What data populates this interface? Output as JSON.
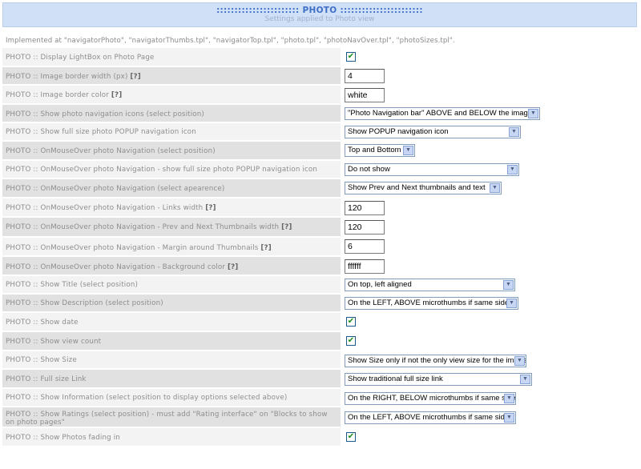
{
  "header": {
    "title": "::::::::::::::::::::::: PHOTO :::::::::::::::::::::::",
    "subtitle": "Settings applied to Photo view"
  },
  "implemented": "Implemented at \"navigatorPhoto\", \"navigatorThumbs.tpl\", \"navigatorTop.tpl\", \"photo.tpl\", \"photoNavOver.tpl\", \"photoSizes.tpl\".",
  "rows": [
    {
      "label": "PHOTO :: Display LightBox on Photo Page",
      "help": "",
      "type": "checkbox",
      "checked": true
    },
    {
      "label": "PHOTO :: Image border width (px)",
      "help": "[?]",
      "type": "text",
      "value": "4"
    },
    {
      "label": "PHOTO :: Image border color",
      "help": "[?]",
      "type": "text",
      "value": "white"
    },
    {
      "label": "PHOTO :: Show photo navigation icons (select position)",
      "help": "",
      "type": "select",
      "value": "\"Photo Navigation bar\" ABOVE and BELOW the image"
    },
    {
      "label": "PHOTO :: Show full size photo POPUP navigation icon",
      "help": "",
      "type": "select",
      "value": "Show POPUP navigation icon"
    },
    {
      "label": "PHOTO :: OnMouseOver photo Navigation (select position)",
      "help": "",
      "type": "select",
      "value": "Top and Bottom"
    },
    {
      "label": "PHOTO :: OnMouseOver photo Navigation - show full size photo POPUP navigation icon",
      "help": "",
      "type": "select",
      "value": "Do not show"
    },
    {
      "label": "PHOTO :: OnMouseOver photo Navigation (select apearence)",
      "help": "",
      "type": "select",
      "value": "Show Prev and Next thumbnails and text"
    },
    {
      "label": "PHOTO :: OnMouseOver photo Navigation - Links width",
      "help": "[?]",
      "type": "text",
      "value": "120"
    },
    {
      "label": "PHOTO :: OnMouseOver photo Navigation - Prev and Next Thumbnails width",
      "help": "[?]",
      "type": "text",
      "value": "120"
    },
    {
      "label": "PHOTO :: OnMouseOver photo Navigation - Margin around Thumbnails",
      "help": "[?]",
      "type": "text",
      "value": "6"
    },
    {
      "label": "PHOTO :: OnMouseOver photo Navigation - Background color",
      "help": "[?]",
      "type": "text",
      "value": "ffffff"
    },
    {
      "label": "PHOTO :: Show Title (select position)",
      "help": "",
      "type": "select",
      "value": "On top, left aligned"
    },
    {
      "label": "PHOTO :: Show Description (select position)",
      "help": "",
      "type": "select",
      "value": "On the LEFT, ABOVE microthumbs if same side"
    },
    {
      "label": "PHOTO :: Show date",
      "help": "",
      "type": "checkbox",
      "checked": true
    },
    {
      "label": "PHOTO :: Show view count",
      "help": "",
      "type": "checkbox",
      "checked": true
    },
    {
      "label": "PHOTO :: Show Size",
      "help": "",
      "type": "select",
      "value": "Show Size only if not the only view size for the image"
    },
    {
      "label": "PHOTO :: Full size Link",
      "help": "",
      "type": "select",
      "value": "Show traditional full size link"
    },
    {
      "label": "PHOTO :: Show Information (select position to display options selected above)",
      "help": "",
      "type": "select",
      "value": "On the RIGHT, BELOW microthumbs if same side"
    },
    {
      "label": "PHOTO :: Show Ratings (select position) - must add \"Rating interface\" on \"Blocks to show on photo pages\"",
      "help": "",
      "type": "select",
      "value": "On the LEFT, ABOVE microthumbs if same side"
    },
    {
      "label": "PHOTO :: Show Photos fading in",
      "help": "",
      "type": "checkbox",
      "checked": true
    }
  ]
}
